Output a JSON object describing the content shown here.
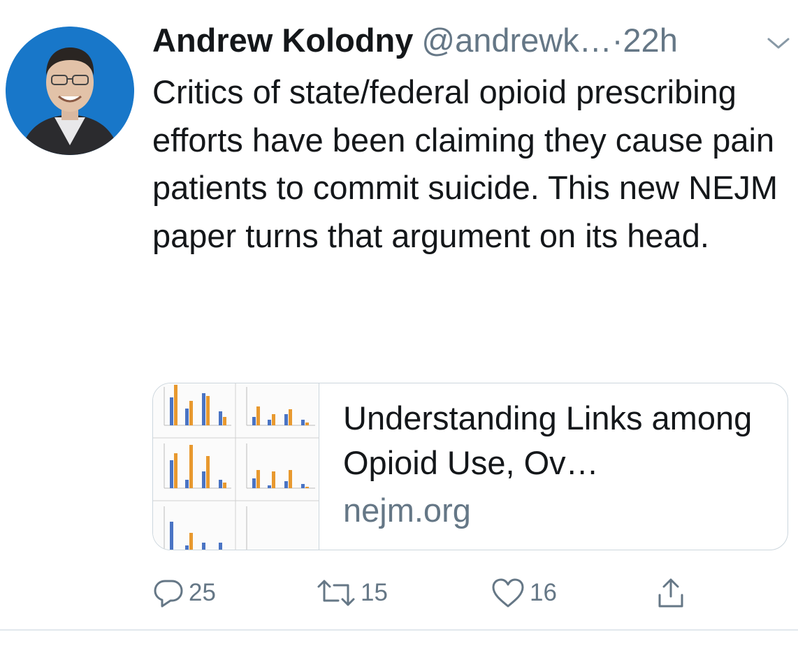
{
  "tweet": {
    "author_name": "Andrew Kolodny",
    "handle": "@andrewk…",
    "time": "·22h",
    "text": "Critics of state/federal opioid prescribing efforts have been claiming they cause pain patients to commit suicide. This new NEJM paper turns that argument on its head."
  },
  "card": {
    "title": "Understanding Links among Opioid Use, Ov…",
    "domain": "nejm.org"
  },
  "actions": {
    "replies": "25",
    "retweets": "15",
    "likes": "16"
  },
  "colors": {
    "text": "#14171a",
    "secondary": "#657786",
    "avatar_bg": "#1877c9",
    "thumb_blue": "#4a74c4",
    "thumb_orange": "#e8992f"
  },
  "icons": [
    "chevron-down-icon",
    "reply-icon",
    "retweet-icon",
    "like-icon",
    "share-icon"
  ]
}
